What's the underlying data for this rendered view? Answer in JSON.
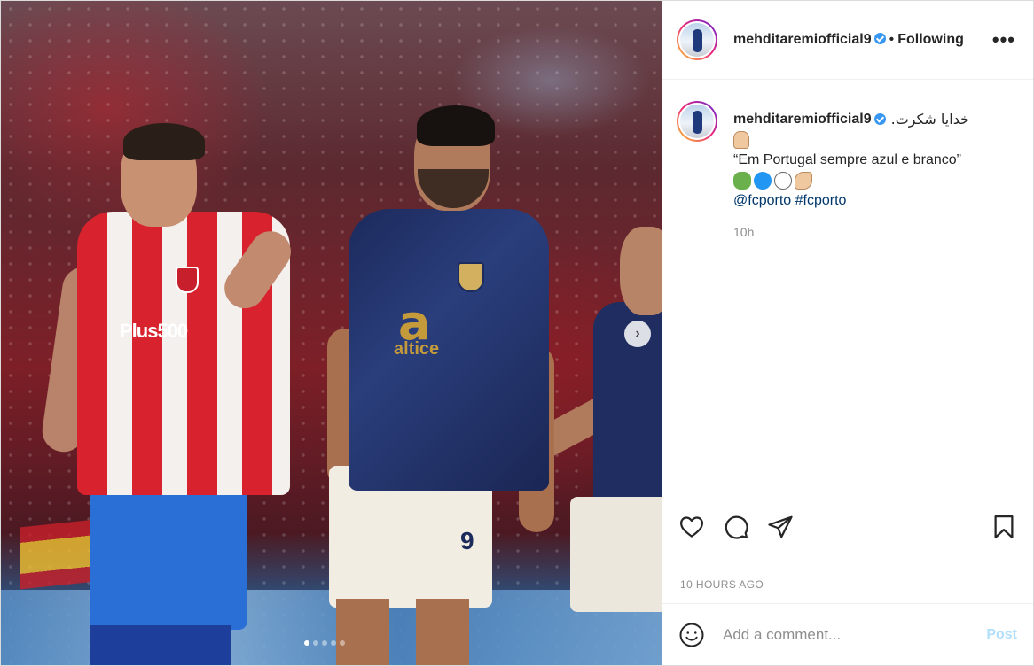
{
  "header": {
    "username": "mehditaremiofficial9",
    "separator": "•",
    "follow_status": "Following",
    "more_icon": "more-options-icon"
  },
  "caption": {
    "username": "mehditaremiofficial9",
    "text_arabic": "خدایا شکرت.",
    "quote": "“Em Portugal sempre azul e branco”",
    "mention": "@fcporto",
    "hashtag": "#fcporto",
    "time_ago": "10h"
  },
  "media": {
    "carousel_count": 5,
    "carousel_active": 0
  },
  "footer": {
    "posted_time": "10 HOURS AGO",
    "comment_placeholder": "Add a comment...",
    "post_label": "Post"
  },
  "colors": {
    "link": "#00376b",
    "verified": "#3897f0",
    "post_button_disabled": "#b2dffc"
  }
}
